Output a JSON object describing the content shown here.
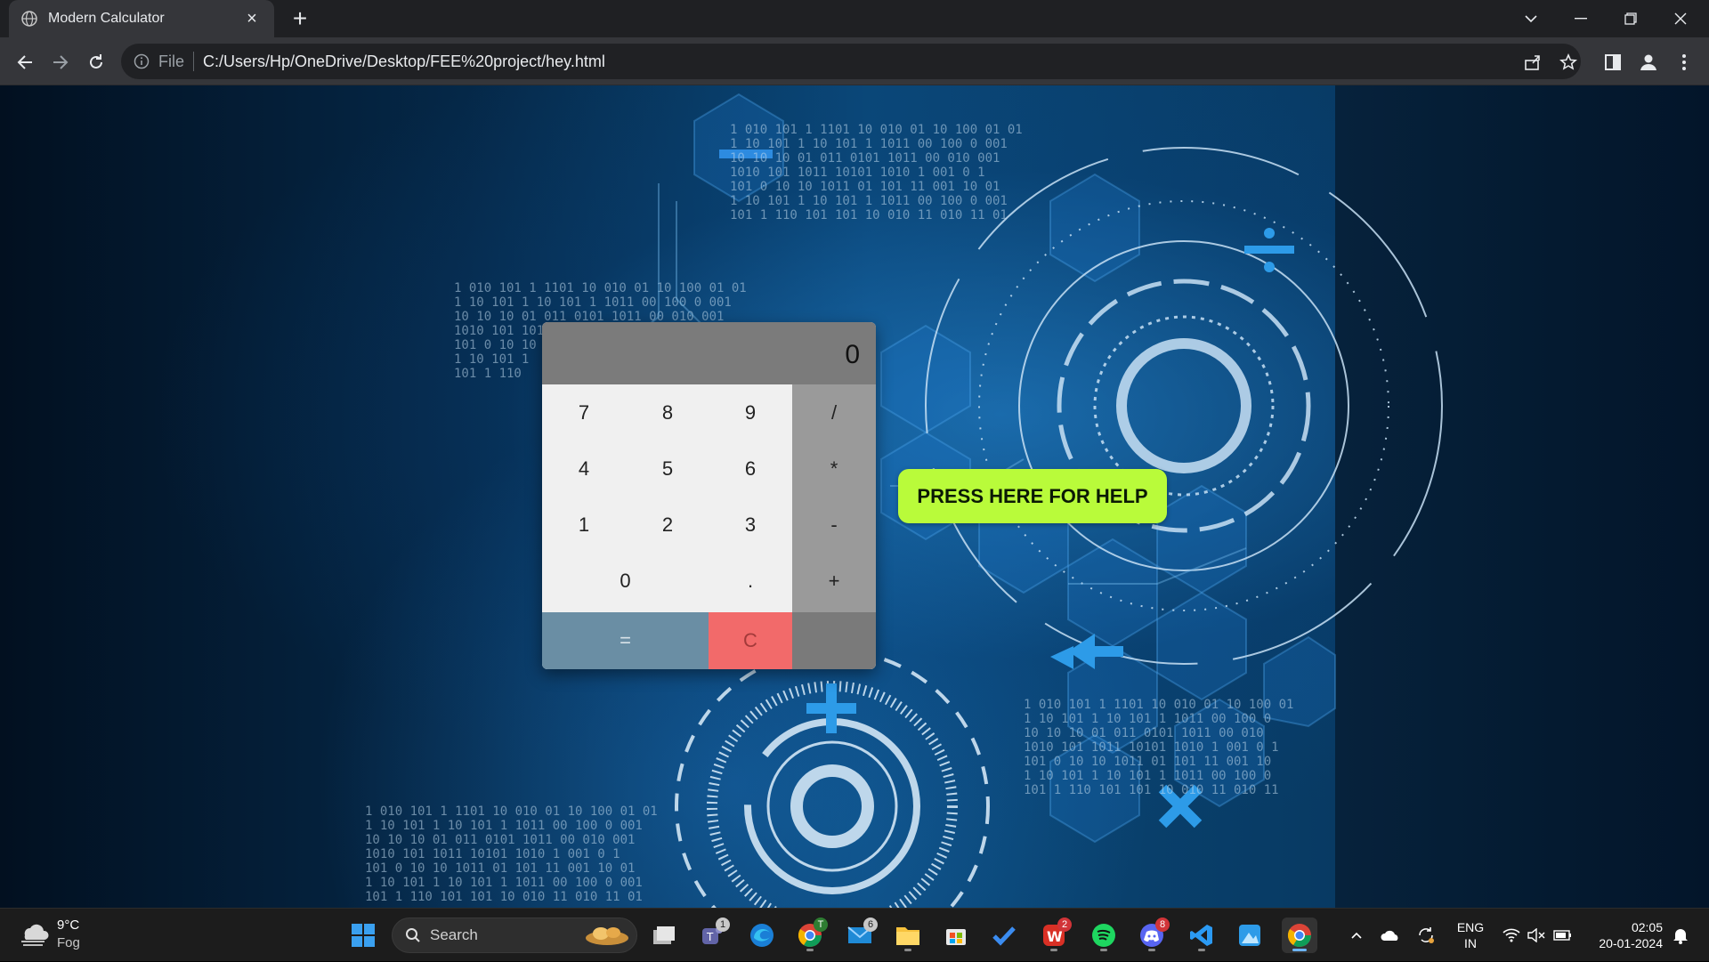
{
  "browser": {
    "tab_title": "Modern Calculator",
    "new_tab": "+",
    "address_prefix": "File",
    "url": "C:/Users/Hp/OneDrive/Desktop/FEE%20project/hey.html"
  },
  "calculator": {
    "display": "0",
    "keys": {
      "k7": "7",
      "k8": "8",
      "k9": "9",
      "div": "/",
      "k4": "4",
      "k5": "5",
      "k6": "6",
      "mul": "*",
      "k1": "1",
      "k2": "2",
      "k3": "3",
      "sub": "-",
      "k0": "0",
      "dot": ".",
      "add": "+",
      "equals": "=",
      "clear": "C"
    }
  },
  "help_button": "PRESS HERE FOR HELP",
  "taskbar": {
    "weather_temp": "9°C",
    "weather_cond": "Fog",
    "search_label": "Search",
    "badges": {
      "teams": "1",
      "chrome_profile": "T",
      "mail": "6",
      "wps": "2",
      "discord": "8"
    },
    "lang_top": "ENG",
    "lang_bottom": "IN",
    "time": "02:05",
    "date": "20-01-2024"
  },
  "colors": {
    "display_bg": "#7b7b7b",
    "operator_col": "#9a9a9a",
    "equals_bg": "#6a8ea4",
    "clear_bg": "#f26a6a",
    "help_bg": "#b9fb3a"
  }
}
